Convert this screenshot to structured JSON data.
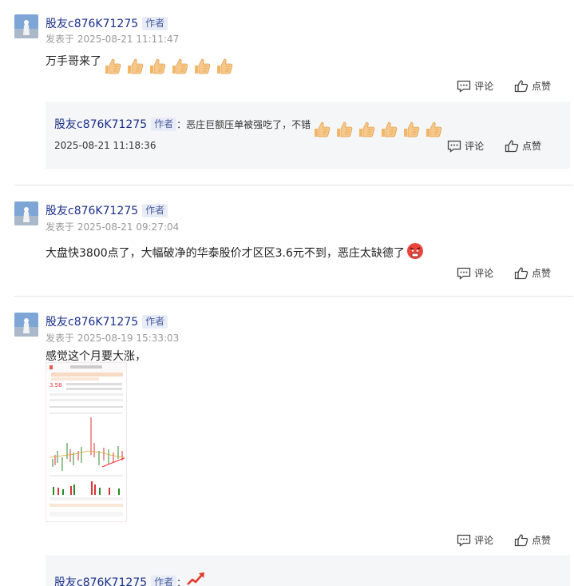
{
  "posts": [
    {
      "username": "股友c876K71275",
      "author_tag": "作者",
      "time": "发表于 2025-08-21 11:11:47",
      "content": "万手哥来了",
      "comment_label": "评论",
      "like_label": "点赞",
      "reply": {
        "username": "股友c876K71275",
        "author_tag": "作者",
        "text": "：恶庄巨额压单被强吃了，不错",
        "time": "2025-08-21 11:18:36",
        "comment_label": "评论",
        "like_label": "点赞"
      }
    },
    {
      "username": "股友c876K71275",
      "author_tag": "作者",
      "time": "发表于 2025-08-21 09:27:04",
      "content": "大盘快3800点了，大幅破净的华泰股价才区区3.6元不到，恶庄太缺德了",
      "comment_label": "评论",
      "like_label": "点赞"
    },
    {
      "username": "股友c876K71275",
      "author_tag": "作者",
      "time": "发表于 2025-08-19 15:33:03",
      "content": "感觉这个月要大涨，",
      "comment_label": "评论",
      "like_label": "点赞",
      "reply": {
        "username": "股友c876K71275",
        "author_tag": "作者",
        "text": "："
      }
    }
  ],
  "icons": {
    "comment": "comment-icon",
    "like": "thumbs-up-icon",
    "emoji_thumb": "thumbs-up-emoji",
    "emoji_angry": "angry-face-emoji",
    "emoji_rise": "rising-arrow-emoji"
  },
  "colors": {
    "username": "#1a2f8a",
    "tag_bg": "#e8ecf6",
    "reply_bg": "#f5f6f7"
  }
}
